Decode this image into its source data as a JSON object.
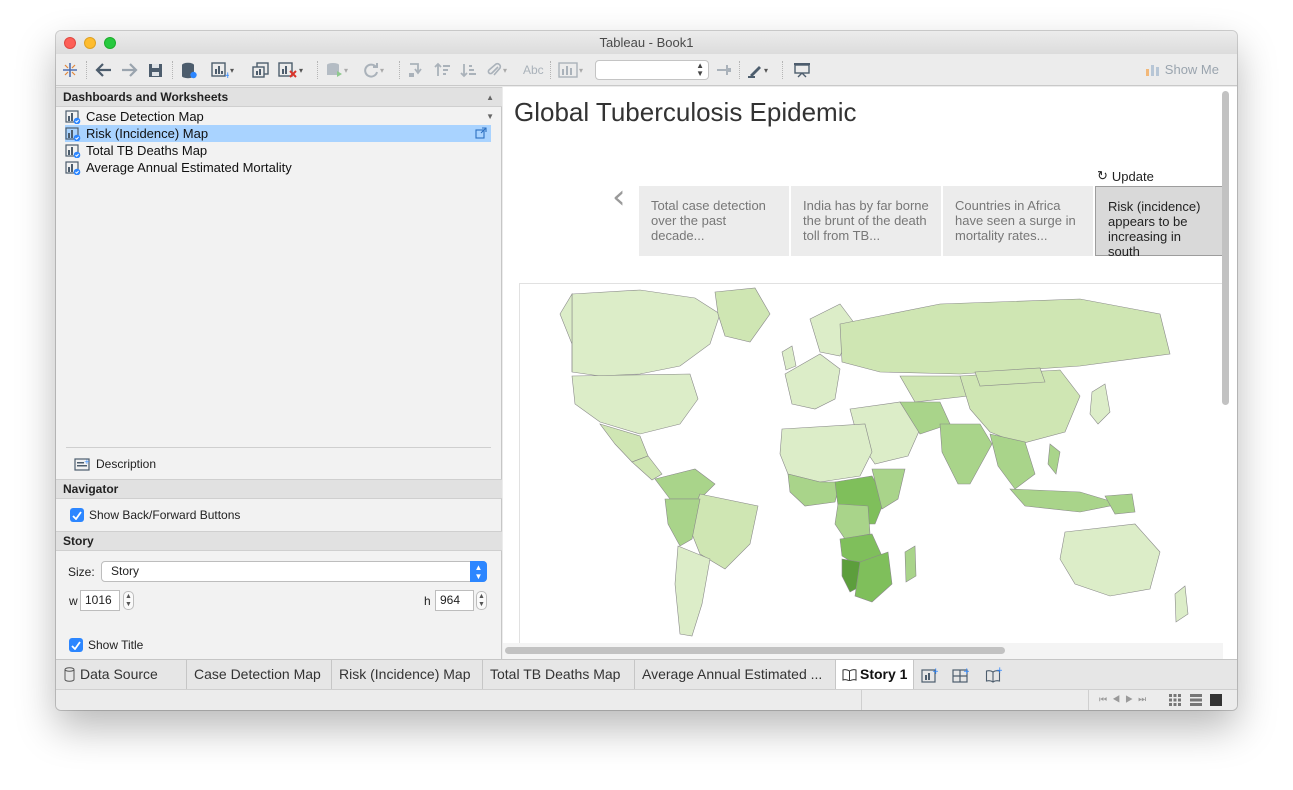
{
  "window": {
    "title": "Tableau - Book1"
  },
  "toolbar": {
    "show_me_label": "Show Me",
    "abc_label": "Abc",
    "fit_value": ""
  },
  "sidebar": {
    "header": "Dashboards and Worksheets",
    "items": [
      {
        "label": "Case Detection Map",
        "selected": false
      },
      {
        "label": "Risk (Incidence) Map",
        "selected": true
      },
      {
        "label": "Total TB Deaths Map",
        "selected": false
      },
      {
        "label": "Average Annual Estimated Mortality",
        "selected": false
      }
    ],
    "description_label": "Description"
  },
  "navigator": {
    "header": "Navigator",
    "show_buttons_label": "Show Back/Forward Buttons",
    "show_buttons_checked": true
  },
  "story_panel": {
    "header": "Story",
    "size_label": "Size:",
    "size_value": "Story",
    "w_label": "w",
    "w_value": "1016",
    "h_label": "h",
    "h_value": "964",
    "show_title_label": "Show Title",
    "show_title_checked": true
  },
  "story": {
    "title": "Global Tuberculosis Epidemic",
    "update_label": "Update",
    "points": [
      {
        "text": "Total case detection over the past decade...",
        "active": false
      },
      {
        "text": "India has by far borne the brunt of the death toll from TB...",
        "active": false
      },
      {
        "text": "Countries in Africa have seen a surge in mortality rates...",
        "active": false
      },
      {
        "text": "Risk (incidence) appears to be increasing in south",
        "active": true
      }
    ]
  },
  "map": {
    "colors": {
      "base": "#cfe6b3",
      "light": "#dcedc8",
      "mid": "#a9d48a",
      "high": "#7fbf5b",
      "peak": "#5c9e3c",
      "border": "#8a8a8a"
    }
  },
  "tabs": {
    "data_source": "Data Source",
    "sheets": [
      "Case Detection Map",
      "Risk (Incidence) Map",
      "Total TB Deaths Map",
      "Average Annual Estimated ..."
    ],
    "story": "Story 1"
  },
  "colors": {
    "accent": "#2c86ff",
    "selection": "#a9d3ff"
  }
}
